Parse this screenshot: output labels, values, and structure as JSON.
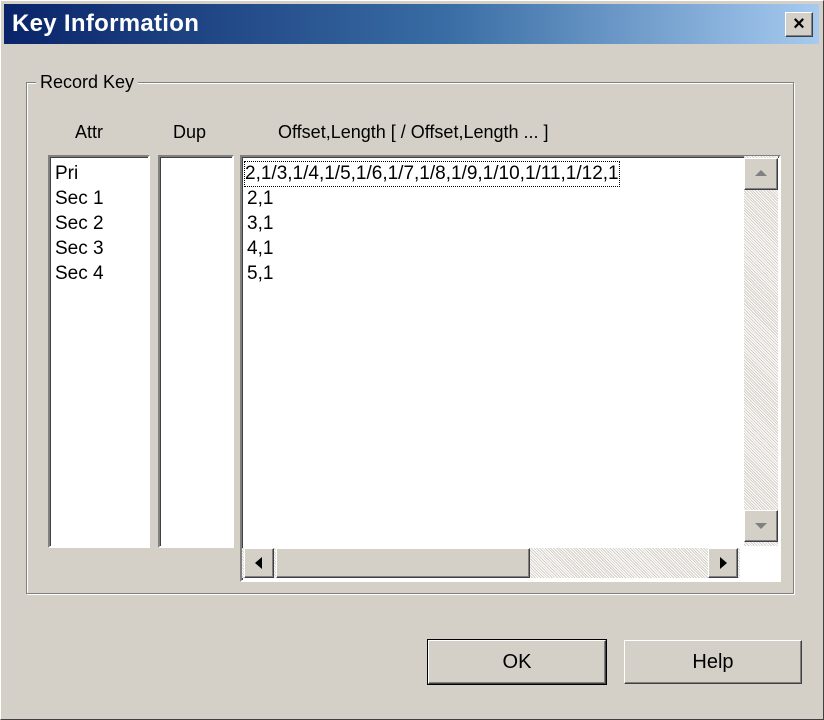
{
  "window": {
    "title": "Key Information",
    "close_glyph": "×"
  },
  "group": {
    "label": "Record Key"
  },
  "columns": {
    "attr": "Attr",
    "dup": "Dup",
    "offset": "Offset,Length [ / Offset,Length ... ]"
  },
  "attr_items": [
    "Pri",
    "Sec  1",
    "Sec  2",
    "Sec  3",
    "Sec  4"
  ],
  "dup_items": [],
  "offset_items": [
    "2,1/3,1/4,1/5,1/6,1/7,1/8,1/9,1/10,1/11,1/12,1",
    "2,1",
    "3,1",
    "4,1",
    "5,1"
  ],
  "buttons": {
    "ok": "OK",
    "help": "Help"
  },
  "icons": {
    "close": "close-icon",
    "scroll_up": "arrow-up-icon",
    "scroll_down": "arrow-down-icon",
    "scroll_left": "arrow-left-icon",
    "scroll_right": "arrow-right-icon"
  }
}
